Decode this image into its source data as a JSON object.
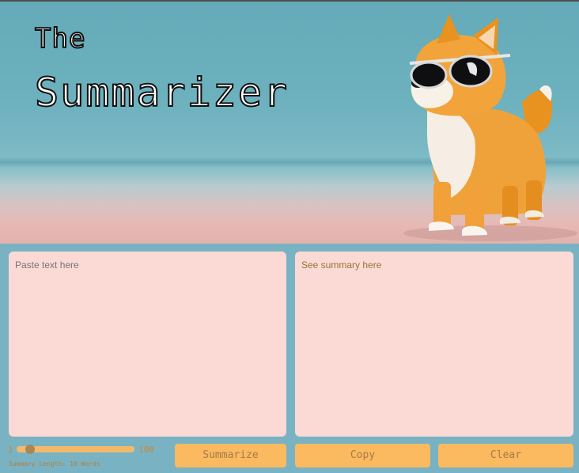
{
  "hero": {
    "title_line1": "The",
    "title_line2": "Summarizer",
    "image": "shiba-inu-dog-with-sunglasses-illustration"
  },
  "input_panel": {
    "placeholder": "Paste text here"
  },
  "output_panel": {
    "placeholder": "See summary here"
  },
  "slider": {
    "min": "1",
    "max": "100",
    "value": 10,
    "label": "Summary Length: 10 Words"
  },
  "buttons": {
    "summarize": "Summarize",
    "copy": "Copy",
    "clear": "Clear"
  },
  "colors": {
    "background": "#79b3c3",
    "panel": "#fbdad5",
    "button": "#fbba5f",
    "accent_text": "#c8873d"
  }
}
